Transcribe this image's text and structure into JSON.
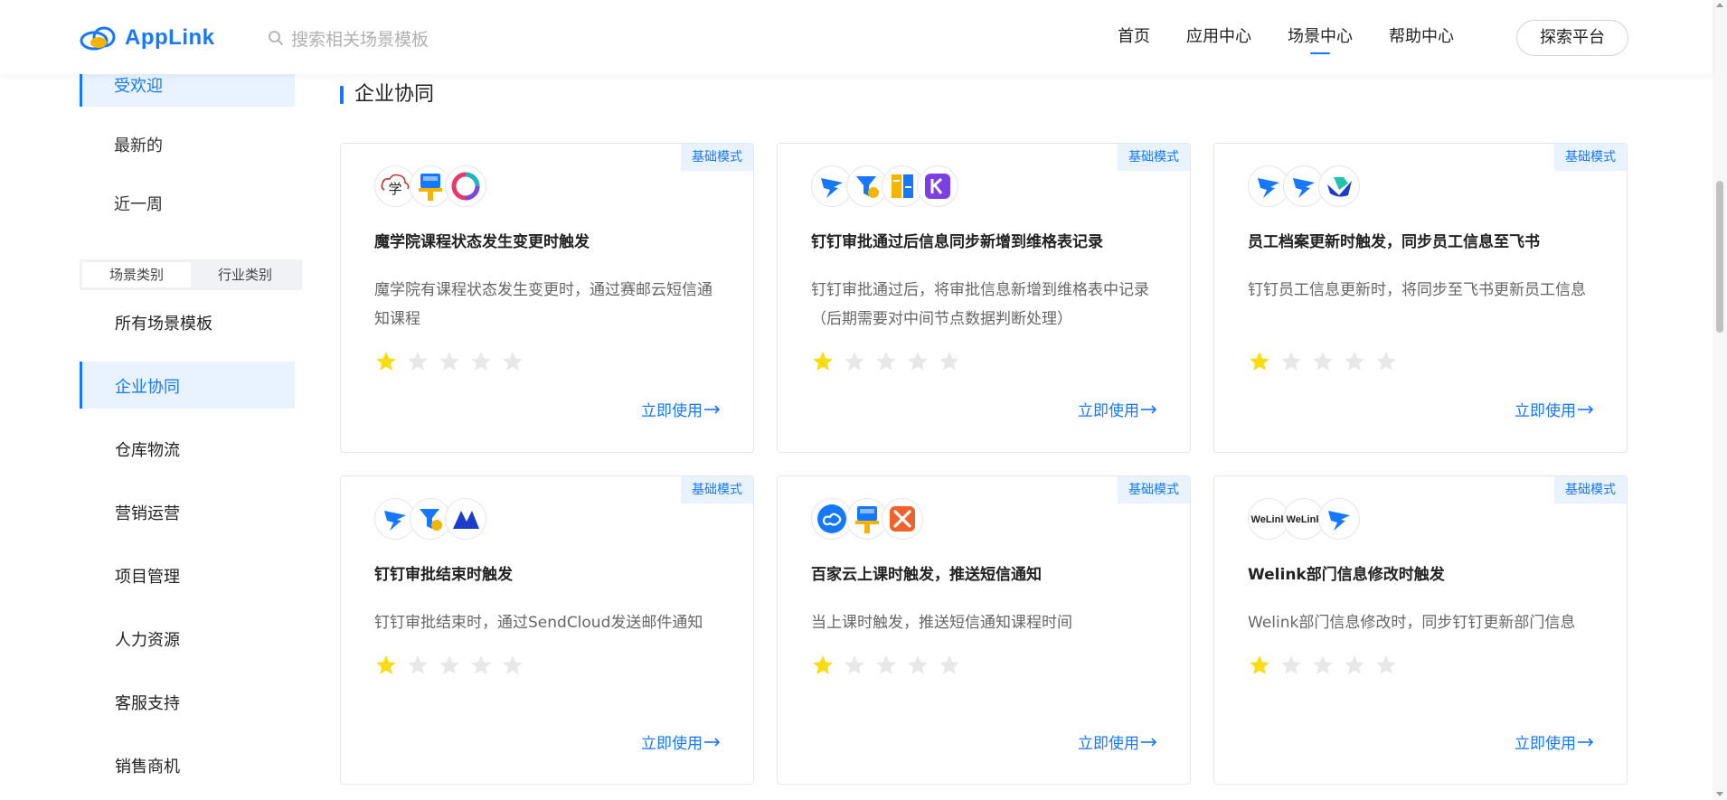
{
  "header": {
    "logo_text": "AppLink",
    "search_placeholder": "搜索相关场景模板",
    "nav": [
      "首页",
      "应用中心",
      "场景中心",
      "帮助中心"
    ],
    "nav_active_index": 2,
    "explore_button": "探索平台"
  },
  "sidebar": {
    "sort_items": [
      "受欢迎",
      "最新的",
      "近一周"
    ],
    "sort_active_index": 0,
    "tabs": [
      "场景类别",
      "行业类别"
    ],
    "tab_active_index": 0,
    "categories": [
      "所有场景模板",
      "企业协同",
      "仓库物流",
      "营销运营",
      "项目管理",
      "人力资源",
      "客服支持",
      "销售商机"
    ],
    "category_active_index": 1
  },
  "main": {
    "section_title": "企业协同",
    "cards": [
      {
        "badge": "基础模式",
        "icons": [
          "mooc-study-icon",
          "paintbrush-app-icon",
          "rainbow-ring-icon"
        ],
        "title": "魔学院课程状态发生变更时触发",
        "desc": "魔学院有课程状态发生变更时，通过赛邮云短信通知课程",
        "rating": 1,
        "action": "立即使用"
      },
      {
        "badge": "基础模式",
        "icons": [
          "dingtalk-icon",
          "dingtalk-approval-icon",
          "weige-table-icon",
          "purple-k-icon"
        ],
        "title": "钉钉审批通过后信息同步新增到维格表记录",
        "desc": "钉钉审批通过后，将审批信息新增到维格表中记录（后期需要对中间节点数据判断处理）",
        "rating": 1,
        "action": "立即使用"
      },
      {
        "badge": "基础模式",
        "icons": [
          "dingtalk-icon",
          "dingtalk-icon",
          "feishu-icon"
        ],
        "title": "员工档案更新时触发，同步员工信息至飞书",
        "desc": "钉钉员工信息更新时，将同步至飞书更新员工信息",
        "rating": 1,
        "action": "立即使用"
      },
      {
        "badge": "基础模式",
        "icons": [
          "dingtalk-icon",
          "dingtalk-approval-icon",
          "sendcloud-icon"
        ],
        "title": "钉钉审批结束时触发",
        "desc": "钉钉审批结束时，通过SendCloud发送邮件通知",
        "rating": 1,
        "action": "立即使用"
      },
      {
        "badge": "基础模式",
        "icons": [
          "baijiayun-icon",
          "paintbrush-app-icon",
          "orange-tools-icon"
        ],
        "title": "百家云上课时触发，推送短信通知",
        "desc": "当上课时触发，推送短信通知课程时间",
        "rating": 1,
        "action": "立即使用"
      },
      {
        "badge": "基础模式",
        "icons": [
          "welink-icon",
          "welink-icon",
          "dingtalk-icon"
        ],
        "icon_texts": [
          "WeLink",
          "WeLink"
        ],
        "title": "Welink部门信息修改时触发",
        "desc": "Welink部门信息修改时，同步钉钉更新部门信息",
        "rating": 1,
        "action": "立即使用"
      }
    ]
  },
  "colors": {
    "accent": "#1677ff",
    "star_on": "#fadb14",
    "star_off": "#e8e8e8",
    "active_bg": "#e8f3ff"
  }
}
